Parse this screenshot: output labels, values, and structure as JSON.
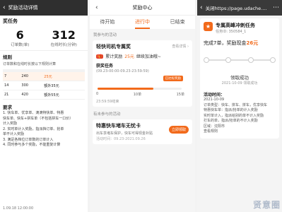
{
  "panel1": {
    "header_title": "奖励活动详情",
    "section_title": "奖任务",
    "stat_orders": {
      "value": "6",
      "label": "订单数(单)"
    },
    "stat_hours": {
      "value": "312",
      "label": "在线时长(分钟)"
    },
    "rules_title": "规则",
    "rules_text": "订单数和在线时长按以下规则计算",
    "table_headers": [
      "",
      "",
      ""
    ],
    "table_rows": [
      {
        "a": "7",
        "b": "240",
        "c": "25元"
      },
      {
        "a": "14",
        "b": "300",
        "c": "额外35元"
      },
      {
        "a": "21",
        "b": "420",
        "c": "额外55元"
      }
    ],
    "req_title": "要求",
    "req_lines": [
      "1. 快车单、优享单、滴滴特快单、特惠",
      "快车单、快车+拼车单（不包括拼车一口价）",
      "计入奖励",
      "2. 实时单计入奖励，指派挡订单、抢单",
      "单不计入奖励",
      "3. 满足各档位订单数的订单计入",
      "4. 同时参与多个奖励，不能重复计算"
    ],
    "footer": "1.09.18 12:00:00"
  },
  "panel2": {
    "header_title": "奖励中心",
    "tabs": [
      "待开始",
      "进行中",
      "已结束"
    ],
    "subhead": "我参与的活动",
    "card_title": "轻快司机专属奖",
    "card_link": "查看详情 ›",
    "reward_text": "累计奖励",
    "reward_amount": "25元",
    "reward_suffix": "继续加油哦~",
    "task_title": "获奖任务",
    "task_time": "(09.23-00:00-09.23-23:59:59)",
    "prog_tip": "已达标奖励",
    "prog_labels": [
      "0",
      "10单",
      "15单"
    ],
    "progress_value": 0.66,
    "deadline": "23:59:59结束",
    "subhead2": "有未参与的活动",
    "card2_title": "特惠快车堵车无忧卡",
    "card2_desc": "出车享堵车保护，快车可得现金补贴",
    "card2_time": "活动时间：09.23-2021.09.26",
    "join_label": "立即领取"
  },
  "panel3": {
    "url": "关闭https://page.udache....",
    "task_title": "专属高峰冲刺任务",
    "task_id": "任务ID: 350584_1",
    "done_prefix": "完成7单，奖励现金",
    "done_amount": "26元",
    "claimed_text": "领取成功",
    "claimed_time": "2021-10-09 领取成功",
    "detail_title": "活动时间：",
    "detail_lines": [
      "2021-10-09",
      "订单类型：快车、拼车、拼车，优享快车",
      "特惠快车单：指派/抢单的计入奖励",
      "实时单计入，指派给别的单不计入奖励",
      "打车的单，指派/抢单的不计入奖励",
      "区域：沈阳市"
    ],
    "view_rules": "查看规则",
    "watermark": "贤意圈"
  }
}
